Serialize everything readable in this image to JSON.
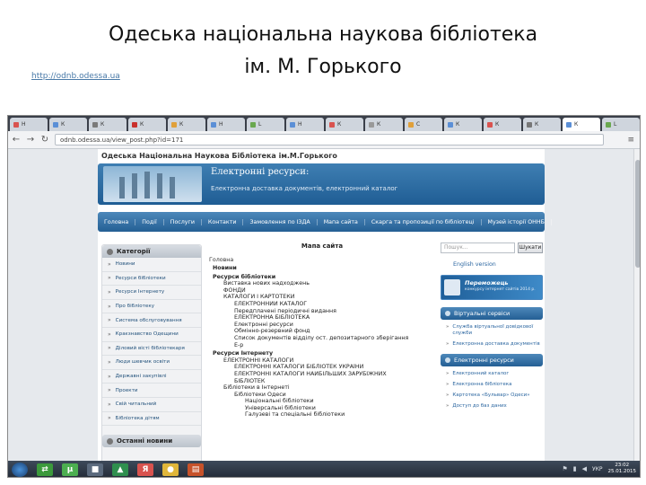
{
  "slide": {
    "title_line1": "Одеська національна наукова бібліотека",
    "title_line2": "ім. М. Горького",
    "url": "http://odnb.odessa.ua"
  },
  "browser": {
    "tabs": [
      {
        "label": "Н",
        "color": "#d9534f"
      },
      {
        "label": "К",
        "color": "#5b8fd6"
      },
      {
        "label": "К",
        "color": "#7a7a7a"
      },
      {
        "label": "К",
        "color": "#c9302c"
      },
      {
        "label": "К",
        "color": "#e0a03a"
      },
      {
        "label": "Н",
        "color": "#5b8fd6"
      },
      {
        "label": "L",
        "color": "#6aa84f"
      },
      {
        "label": "Н",
        "color": "#5b8fd6"
      },
      {
        "label": "К",
        "color": "#d9534f"
      },
      {
        "label": "К",
        "color": "#999999"
      },
      {
        "label": "С",
        "color": "#e0a03a"
      },
      {
        "label": "К",
        "color": "#5b8fd6"
      },
      {
        "label": "К",
        "color": "#d9534f"
      },
      {
        "label": "К",
        "color": "#777777"
      },
      {
        "label": "К",
        "color": "#5b8fd6"
      },
      {
        "label": "L",
        "color": "#6aa84f"
      }
    ],
    "active_tab_index": 14,
    "back_icon": "back-arrow-icon",
    "forward_icon": "forward-arrow-icon",
    "reload_icon": "reload-icon",
    "address": "odnb.odessa.ua/view_post.php?id=171",
    "menu_icon": "menu-icon"
  },
  "site": {
    "name": "Одеська Національна Наукова Бібліотека ім.М.Горького",
    "banner_title": "Електронні ресурси:",
    "banner_subtitle": "Електронна доставка документів, електронний каталог",
    "nav": [
      "Головна",
      "Події",
      "Послуги",
      "Контакти",
      "Замовлення по ІЗДА",
      "Мапа сайта",
      "Скарга та пропозиції по бібліотеці",
      "Музей історії ОННБ"
    ],
    "categories_title": "Категорії",
    "categories": [
      "Новини",
      "Ресурси бібліотеки",
      "Ресурси Інтернету",
      "Про бібліотеку",
      "Система обслуговування",
      "Краєзнавство Одещини",
      "Діловий вісті бібліотекаря",
      "Люди шевчик освіти",
      "Державні закупівлі",
      "Проекти",
      "Свій читальний",
      "Бібліотека дітям"
    ],
    "second_box_title": "Останні новини",
    "content_title": "Мапа сайта",
    "breadcrumb": "Головна",
    "sitemap": [
      {
        "text": "Новини",
        "level": 1,
        "bold": true
      },
      {
        "text": "Ресурси бібліотеки",
        "level": 1,
        "bold": true
      },
      {
        "text": "Виставка нових надходжень",
        "level": 2,
        "bold": false
      },
      {
        "text": "ФОНДИ",
        "level": 2,
        "bold": false
      },
      {
        "text": "КАТАЛОГИ І КАРТОТЕКИ",
        "level": 2,
        "bold": false
      },
      {
        "text": "ЕЛЕКТРОННИЙ КАТАЛОГ",
        "level": 3,
        "bold": false
      },
      {
        "text": "Передплачені періодичні видання",
        "level": 3,
        "bold": false
      },
      {
        "text": "ЕЛЕКТРОННА БІБЛІОТЕКА",
        "level": 3,
        "bold": false
      },
      {
        "text": "Електронні ресурси",
        "level": 3,
        "bold": false
      },
      {
        "text": "Обмінно-резервний фонд",
        "level": 3,
        "bold": false
      },
      {
        "text": "Список документів відділу ост. депозитарного зберігання",
        "level": 3,
        "bold": false
      },
      {
        "text": "Е-р",
        "level": 3,
        "bold": false
      },
      {
        "text": "Ресурси Інтернету",
        "level": 1,
        "bold": true
      },
      {
        "text": "ЕЛЕКТРОННІ КАТАЛОГИ",
        "level": 2,
        "bold": false
      },
      {
        "text": "ЕЛЕКТРОННІ КАТАЛОГИ БІБЛІОТЕК УКРАЇНИ",
        "level": 3,
        "bold": false
      },
      {
        "text": "ЕЛЕКТРОННІ КАТАЛОГИ НАЙБІЛЬШИХ ЗАРУБІЖНИХ",
        "level": 3,
        "bold": false
      },
      {
        "text": "БІБЛІОТЕК",
        "level": 3,
        "bold": false
      },
      {
        "text": "Бібліотеки в Інтернеті",
        "level": 2,
        "bold": false
      },
      {
        "text": "Бібліотеки Одеси",
        "level": 3,
        "bold": false
      },
      {
        "text": "Національні бібліотеки",
        "level": 4,
        "bold": false
      },
      {
        "text": "Універсальні бібліотеки",
        "level": 4,
        "bold": false
      },
      {
        "text": "Галузеві та спеціальні бібліотеки",
        "level": 4,
        "bold": false
      }
    ],
    "search_placeholder": "Пошук...",
    "search_button": "Шукати",
    "english_link": "English version",
    "promo_title": "Переможець",
    "promo_text": "конкурсу інтернет сайтів 2014 р.",
    "virtual_services_title": "Віртуальні сервіси",
    "virtual_services": [
      "Служба віртуальної довідкової служби",
      "Електронна доставка документів"
    ],
    "electronic_resources_title": "Електронні ресурси",
    "electronic_resources": [
      "Електронний каталог",
      "Електронна бібліотека",
      "Картотека «Бульвар» Одеси»",
      "Доступ до баз даних"
    ]
  },
  "taskbar": {
    "start_icon": "windows-start-icon",
    "apps": [
      {
        "icon": "app-green-arrows-icon",
        "glyph": "⇄",
        "color": "#3c9a3c"
      },
      {
        "icon": "utorrent-icon",
        "glyph": "µ",
        "color": "#4caf50"
      },
      {
        "icon": "disk-icon",
        "glyph": "■",
        "color": "#5b6a7d"
      },
      {
        "icon": "drive-icon",
        "glyph": "▲",
        "color": "#2f8f4e"
      },
      {
        "icon": "yandex-icon",
        "glyph": "Я",
        "color": "#d9534f"
      },
      {
        "icon": "chrome-icon",
        "glyph": "●",
        "color": "#e0b63a"
      },
      {
        "icon": "document-icon",
        "glyph": "▤",
        "color": "#c7522a"
      }
    ],
    "language": "УКР",
    "time": "23:02",
    "date": "25.01.2015"
  }
}
